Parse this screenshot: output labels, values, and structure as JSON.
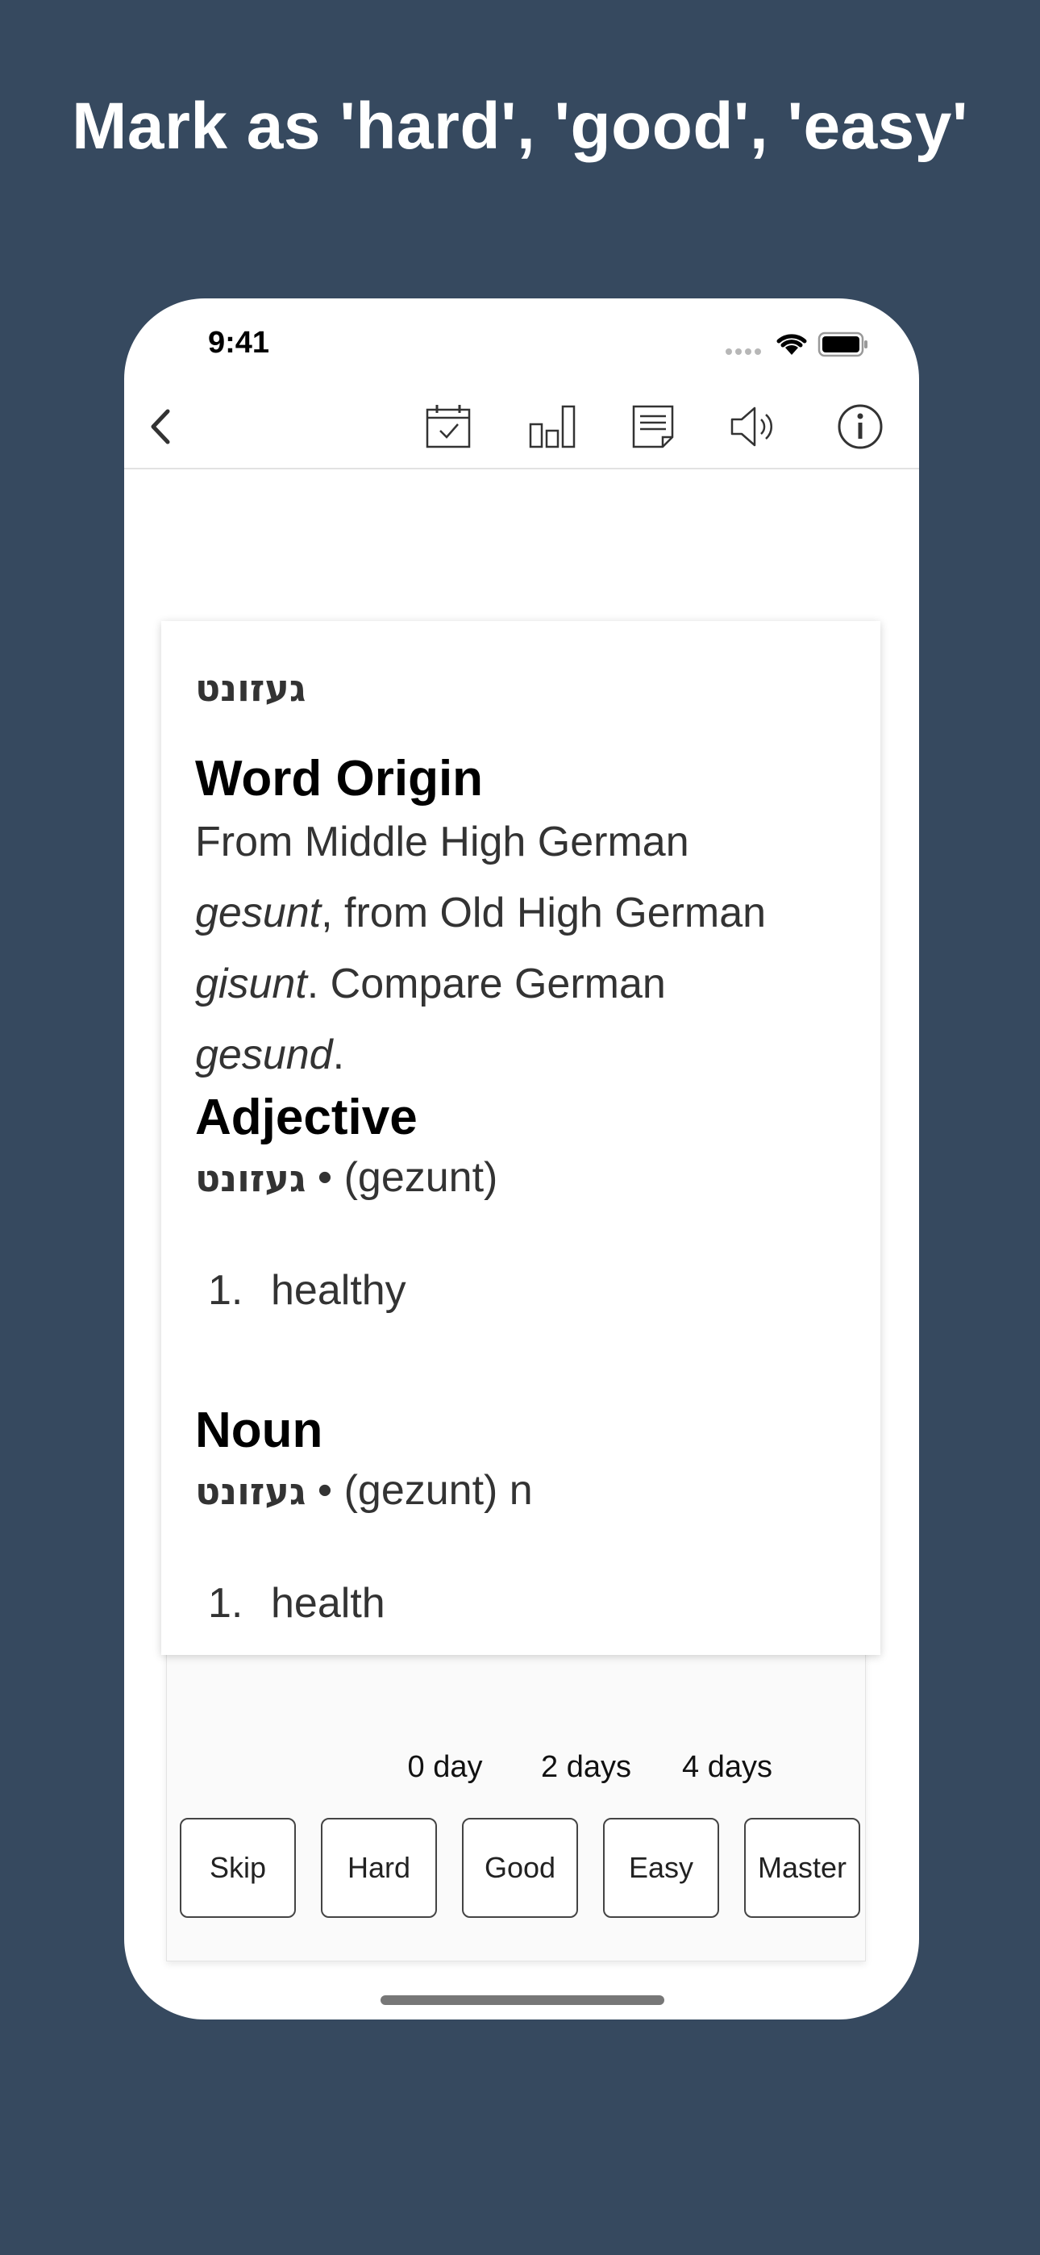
{
  "headline": "Mark as 'hard', 'good', 'easy'",
  "status_bar": {
    "time": "9:41"
  },
  "toolbar": {
    "icons": [
      "back-chevron-icon",
      "calendar-check-icon",
      "bar-chart-icon",
      "notes-icon",
      "speaker-icon",
      "info-icon"
    ]
  },
  "card": {
    "headword": "געזונט",
    "word_origin": {
      "title": "Word Origin",
      "line1": "From Middle High German",
      "line2_italic": "gesunt",
      "line2_rest": ", from Old High German",
      "line3_italic": "gisunt",
      "line3_rest": ". Compare German",
      "line4_italic": "gesund",
      "line4_rest": "."
    },
    "adjective": {
      "title": "Adjective",
      "headword": "געזונט",
      "pronunciation": " • (gezunt)",
      "definitions": [
        {
          "num": "1.",
          "text": "healthy"
        }
      ]
    },
    "noun": {
      "title": "Noun",
      "headword": "געזונט",
      "pronunciation": " • (gezunt) n",
      "definitions": [
        {
          "num": "1.",
          "text": "health"
        }
      ]
    }
  },
  "intervals": {
    "hard": "0 day",
    "good": "2 days",
    "easy": "4 days"
  },
  "buttons": {
    "skip": "Skip",
    "hard": "Hard",
    "good": "Good",
    "easy": "Easy",
    "master": "Master"
  },
  "colors": {
    "background": "#36495f",
    "phone": "#ffffff",
    "button_border": "#444444"
  }
}
